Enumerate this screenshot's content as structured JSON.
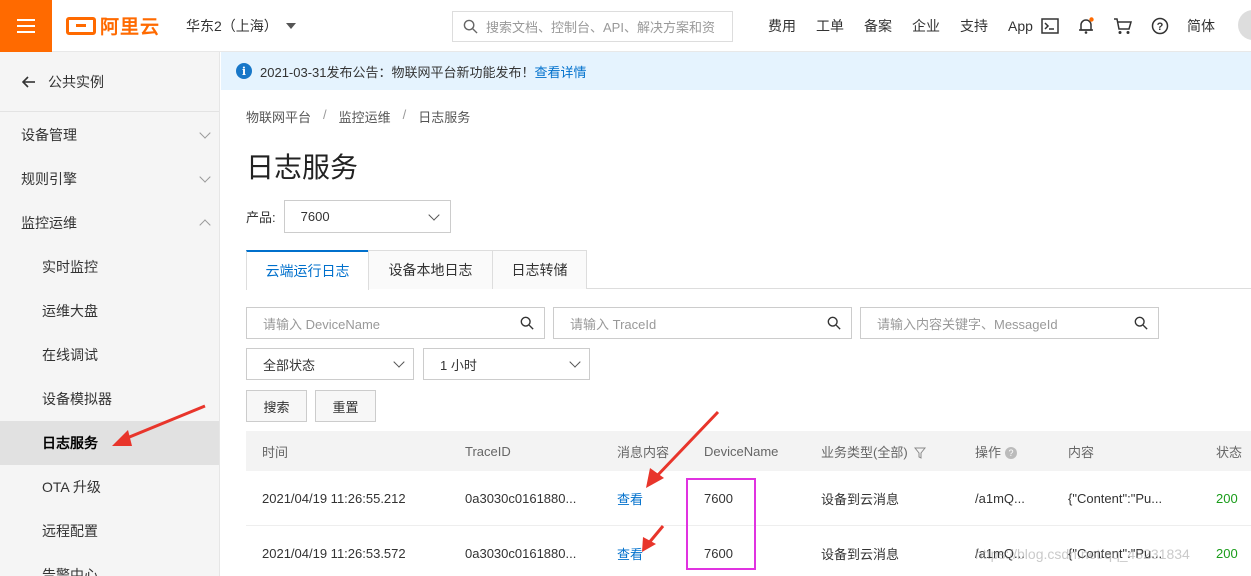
{
  "topbar": {
    "logo_text": "阿里云",
    "region": "华东2（上海）",
    "search_placeholder": "搜索文档、控制台、API、解决方案和资",
    "links": [
      "费用",
      "工单",
      "备案",
      "企业",
      "支持",
      "App"
    ],
    "lang": "简体"
  },
  "sidebar": {
    "back": "公共实例",
    "groups": [
      {
        "label": "设备管理"
      },
      {
        "label": "规则引擎"
      },
      {
        "label": "监控运维"
      }
    ],
    "subitems": [
      "实时监控",
      "运维大盘",
      "在线调试",
      "设备模拟器",
      "日志服务",
      "OTA 升级",
      "远程配置",
      "告警中心"
    ]
  },
  "notice": {
    "text": "2021-03-31发布公告：物联网平台新功能发布！",
    "link": "查看详情"
  },
  "breadcrumb": [
    "物联网平台",
    "监控运维",
    "日志服务"
  ],
  "page_title": "日志服务",
  "product": {
    "label": "产品:",
    "value": "7600"
  },
  "tabs": [
    "云端运行日志",
    "设备本地日志",
    "日志转储"
  ],
  "filters": {
    "device_ph": "请输入 DeviceName",
    "trace_ph": "请输入 TraceId",
    "content_ph": "请输入内容关键字、MessageId",
    "status": "全部状态",
    "time": "1 小时",
    "search_btn": "搜索",
    "reset_btn": "重置"
  },
  "table": {
    "headers": [
      "时间",
      "TraceID",
      "消息内容",
      "DeviceName",
      "业务类型(全部)",
      "操作",
      "内容",
      "状态"
    ],
    "rows": [
      {
        "time": "2021/04/19 11:26:55.212",
        "trace": "0a3030c0161880...",
        "msg": "查看",
        "device": "7600",
        "type": "设备到云消息",
        "op": "/a1mQ...",
        "content": "{\"Content\":\"Pu...",
        "status": "200"
      },
      {
        "time": "2021/04/19 11:26:53.572",
        "trace": "0a3030c0161880...",
        "msg": "查看",
        "device": "7600",
        "type": "设备到云消息",
        "op": "/a1mQ...",
        "content": "{\"Content\":\"Pu...",
        "status": "200"
      }
    ]
  },
  "watermark": "https://blog.csdn.net/qq_43231834",
  "colors": {
    "brand": "#ff6a00",
    "link": "#0070cc",
    "annotation_red": "#e8352b",
    "annotation_magenta": "#e032e0"
  }
}
